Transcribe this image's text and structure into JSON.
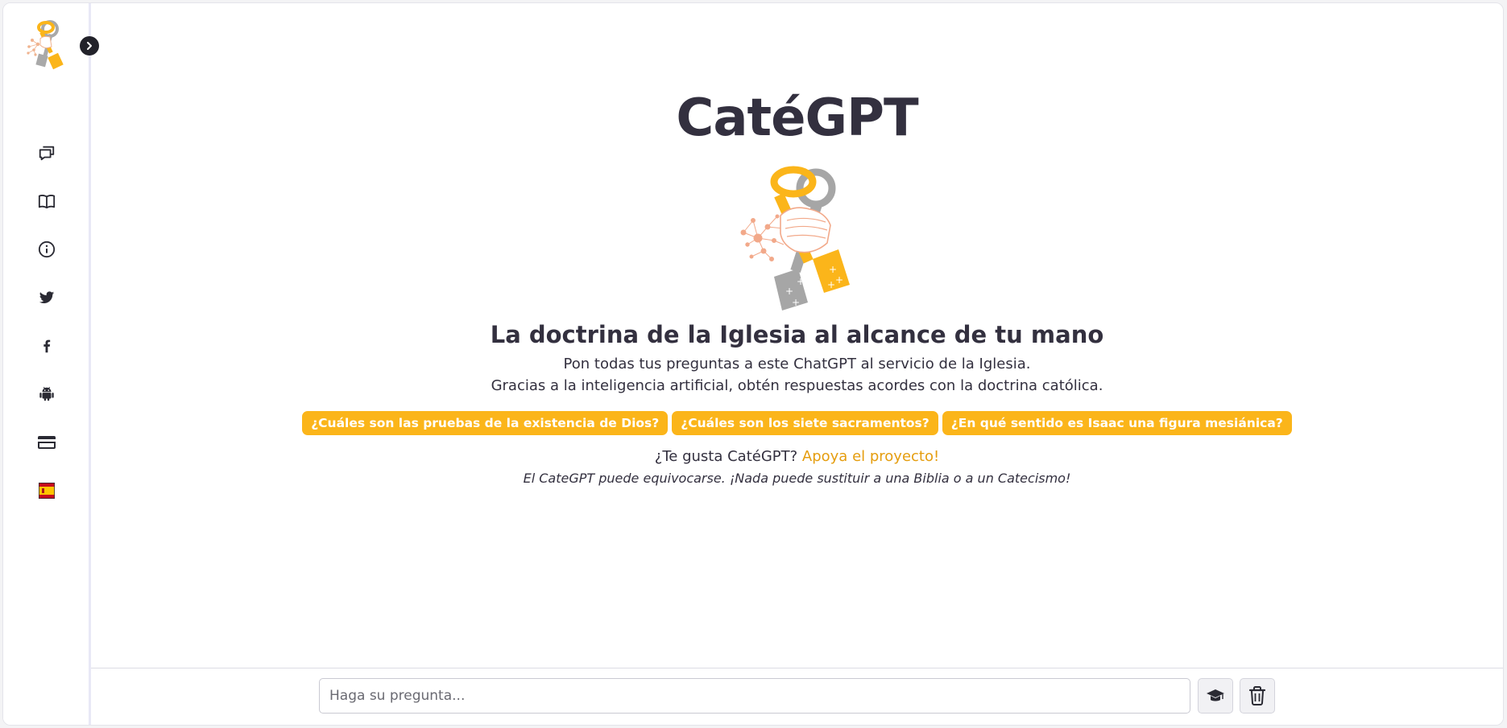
{
  "app": {
    "title": "CatéGPT"
  },
  "sidebar": {
    "items": [
      {
        "name": "chat-icon"
      },
      {
        "name": "book-icon"
      },
      {
        "name": "info-icon"
      },
      {
        "name": "twitter-icon"
      },
      {
        "name": "facebook-icon"
      },
      {
        "name": "android-icon"
      },
      {
        "name": "credit-card-icon"
      },
      {
        "name": "spain-flag-icon"
      }
    ],
    "toggle_icon": "chevron-right-icon"
  },
  "main": {
    "title": "CatéGPT",
    "subtitle": "La doctrina de la Iglesia al alcance de tu mano",
    "description_line1": "Pon todas tus preguntas a este ChatGPT al servicio de la Iglesia.",
    "description_line2": "Gracias a la inteligencia artificial, obtén respuestas acordes con la doctrina católica.",
    "suggestions": [
      "¿Cuáles son las pruebas de la existencia de Dios?",
      "¿Cuáles son los siete sacramentos?",
      "¿En qué sentido es Isaac una figura mesiánica?"
    ],
    "support_text": "¿Te gusta CatéGPT?",
    "support_link": "Apoya el proyecto!",
    "disclaimer": "El CateGPT puede equivocarse. ¡Nada puede sustituir a una Biblia o a un Catecismo!"
  },
  "input": {
    "placeholder": "Haga su pregunta...",
    "value": ""
  },
  "colors": {
    "accent": "#fbb51a",
    "link": "#e59d0e",
    "text": "#33303f",
    "toggle_bg": "#22222a"
  }
}
